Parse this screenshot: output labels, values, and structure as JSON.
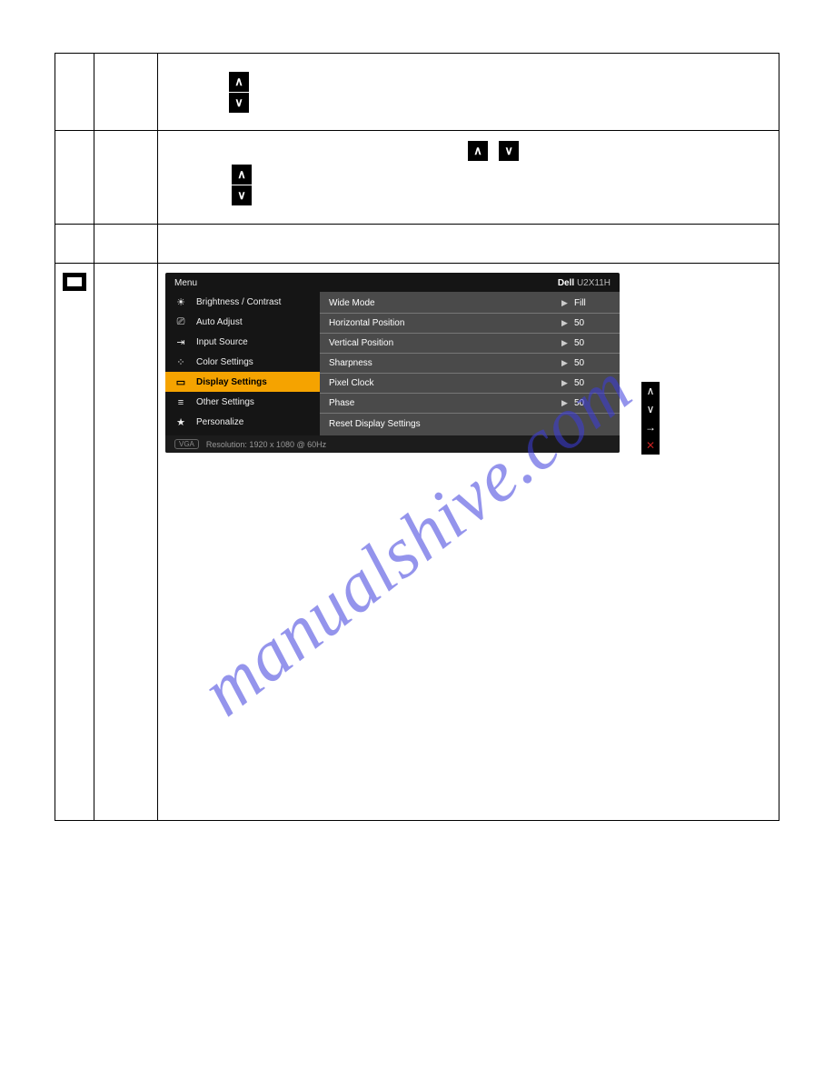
{
  "watermark": "manualshive.com",
  "osd": {
    "menu_label": "Menu",
    "brand": "Dell",
    "model": "U2X11H",
    "left_items": [
      {
        "icon": "☀",
        "label": "Brightness / Contrast",
        "active": false
      },
      {
        "icon": "⎚",
        "label": "Auto Adjust",
        "active": false
      },
      {
        "icon": "⇥",
        "label": "Input Source",
        "active": false
      },
      {
        "icon": "⁘",
        "label": "Color Settings",
        "active": false
      },
      {
        "icon": "▭",
        "label": "Display Settings",
        "active": true
      },
      {
        "icon": "≡",
        "label": "Other Settings",
        "active": false
      },
      {
        "icon": "★",
        "label": "Personalize",
        "active": false
      }
    ],
    "right_options": [
      {
        "label": "Wide Mode",
        "value": "Fill",
        "arrow": true
      },
      {
        "label": "Horizontal Position",
        "value": "50",
        "arrow": true
      },
      {
        "label": "Vertical Position",
        "value": "50",
        "arrow": true
      },
      {
        "label": "Sharpness",
        "value": "50",
        "arrow": true
      },
      {
        "label": "Pixel Clock",
        "value": "50",
        "arrow": true
      },
      {
        "label": "Phase",
        "value": "50",
        "arrow": true
      },
      {
        "label": "Reset Display Settings",
        "value": "",
        "arrow": false
      }
    ],
    "footer_badge": "VGA",
    "footer_text": "Resolution: 1920 x 1080 @ 60Hz",
    "side_controls": [
      {
        "glyph": "∧",
        "cls": ""
      },
      {
        "glyph": "∨",
        "cls": ""
      },
      {
        "glyph": "→",
        "cls": ""
      },
      {
        "glyph": "✕",
        "cls": "red"
      }
    ]
  },
  "glyphs": {
    "up": "∧",
    "down": "∨"
  }
}
